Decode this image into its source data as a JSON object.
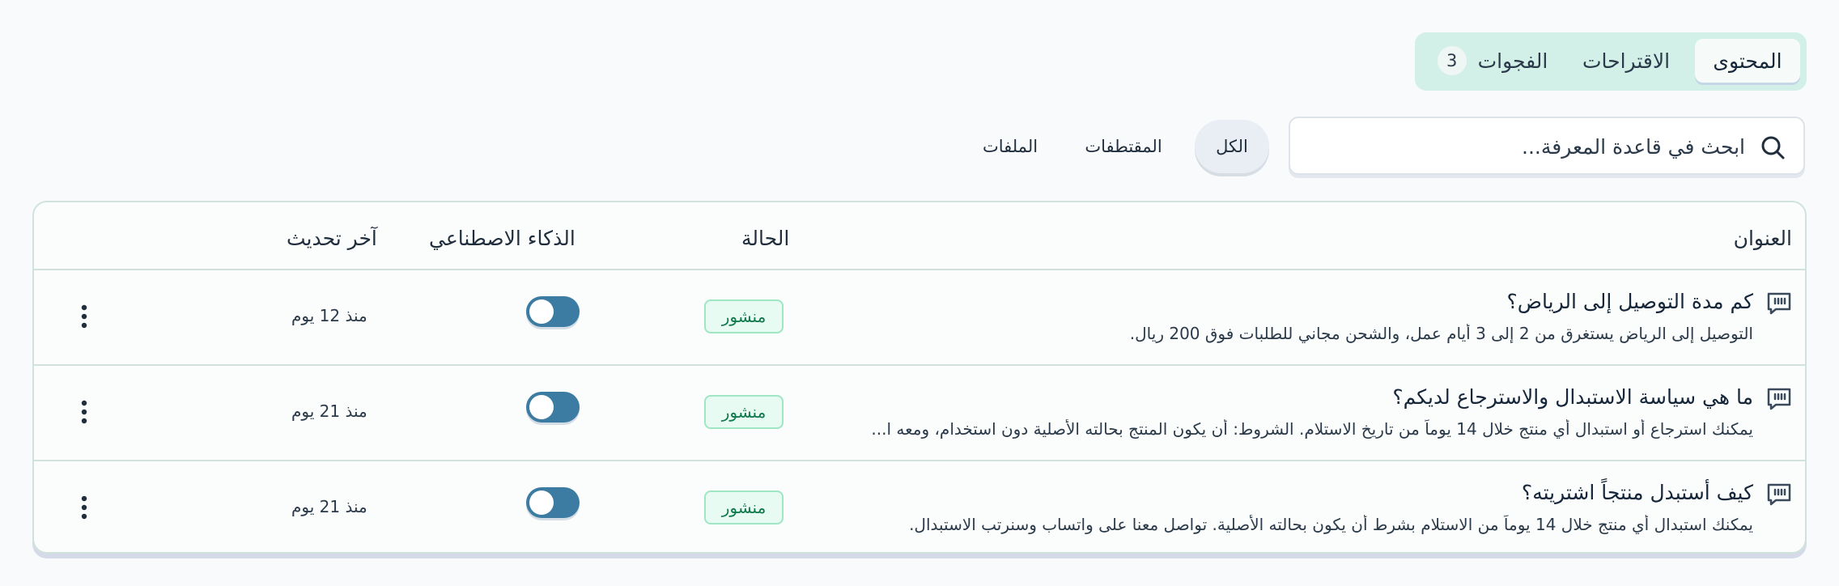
{
  "tabs": [
    {
      "label": "المحتوى",
      "active": true
    },
    {
      "label": "الاقتراحات",
      "active": false
    },
    {
      "label": "الفجوات",
      "badge": "3",
      "active": false
    }
  ],
  "search": {
    "placeholder": "ابحث في قاعدة المعرفة..."
  },
  "filters": [
    {
      "label": "الكل",
      "active": true
    },
    {
      "label": "المقتطفات",
      "active": false
    },
    {
      "label": "الملفات",
      "active": false
    }
  ],
  "table": {
    "headers": {
      "title": "العنوان",
      "status": "الحالة",
      "ai": "الذكاء الاصطناعي",
      "updated": "آخر تحديث"
    },
    "rows": [
      {
        "title": "كم مدة التوصيل إلى الرياض؟",
        "description": "التوصيل إلى الرياض يستغرق من 2 إلى 3 أيام عمل، والشحن مجاني للطلبات فوق 200 ريال.",
        "status": "منشور",
        "ai_enabled": true,
        "updated": "منذ 12 يوم"
      },
      {
        "title": "ما هي سياسة الاستبدال والاسترجاع لديكم؟",
        "description": "يمكنك استرجاع أو استبدال أي منتج خلال 14 يوماً من تاريخ الاستلام. الشروط: أن يكون المنتج بحالته الأصلية دون استخدام، ومعه ا...",
        "status": "منشور",
        "ai_enabled": true,
        "updated": "منذ 21 يوم"
      },
      {
        "title": "كيف أستبدل منتجاً اشتريته؟",
        "description": "يمكنك استبدال أي منتج خلال 14 يوماً من الاستلام بشرط أن يكون بحالته الأصلية. تواصل معنا على واتساب وسنرتب الاستبدال.",
        "status": "منشور",
        "ai_enabled": true,
        "updated": "منذ 21 يوم"
      }
    ]
  },
  "colors": {
    "accent": "#3c7ba2",
    "published_bg": "#e8fbf3",
    "published_text": "#0f7a4c",
    "tabs_bg": "#d3f0e8"
  },
  "icons": {
    "search": "search-icon",
    "row": "quote-icon",
    "menu": "kebab-menu-icon"
  }
}
